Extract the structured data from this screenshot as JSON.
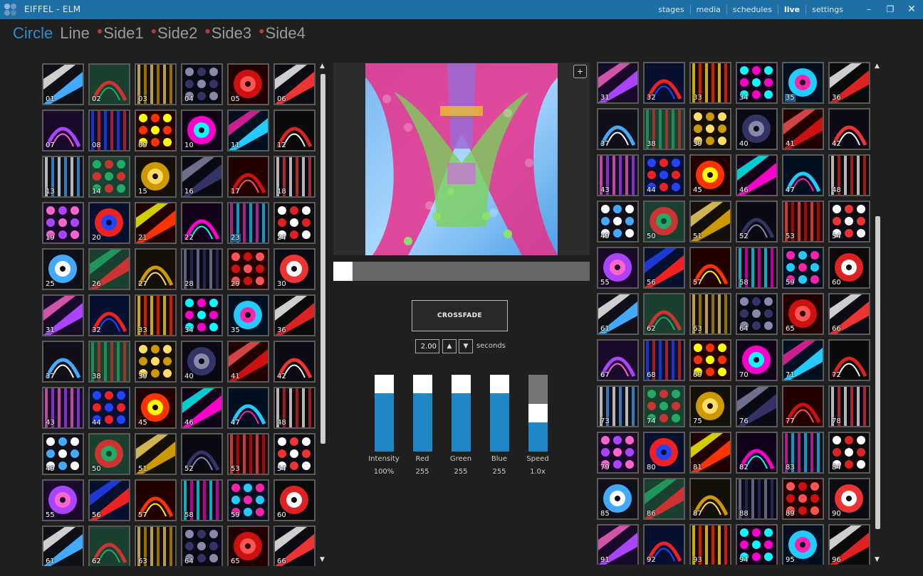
{
  "app": {
    "title": "EIFFEL - ELM",
    "nav": [
      "stages",
      "media",
      "schedules",
      "live",
      "settings"
    ],
    "nav_active": "live",
    "window_controls": [
      "minimize-icon",
      "restore-icon",
      "close-icon"
    ]
  },
  "stage_tabs": [
    {
      "label": "Circle",
      "active": true,
      "dot": false
    },
    {
      "label": "Line",
      "active": false,
      "dot": false
    },
    {
      "label": "Side1",
      "active": false,
      "dot": true
    },
    {
      "label": "Side2",
      "active": false,
      "dot": true
    },
    {
      "label": "Side3",
      "active": false,
      "dot": true
    },
    {
      "label": "Side4",
      "active": false,
      "dot": true
    }
  ],
  "left_grid": {
    "first": 1,
    "last": 66,
    "selected": "23"
  },
  "right_grid": {
    "first": 31,
    "last": 96,
    "selected": "35"
  },
  "preview": {
    "add_label": "+"
  },
  "crossfade": {
    "label": "CROSSFADE",
    "seconds_value": "2.00",
    "seconds_label": "seconds",
    "position": 0.0
  },
  "controls": [
    {
      "label": "Intensity",
      "value": "100%",
      "level": 0.76
    },
    {
      "label": "Red",
      "value": "255",
      "level": 0.76
    },
    {
      "label": "Green",
      "value": "255",
      "level": 0.76
    },
    {
      "label": "Blue",
      "value": "255",
      "level": 0.76
    },
    {
      "label": "Speed",
      "value": "1.0x",
      "level": 0.38
    }
  ],
  "colors": {
    "accent": "#1d6fa6",
    "bar_fill": "#1e87c4",
    "tab_active": "#2b8fcf",
    "tab_dot": "#c0392b"
  }
}
